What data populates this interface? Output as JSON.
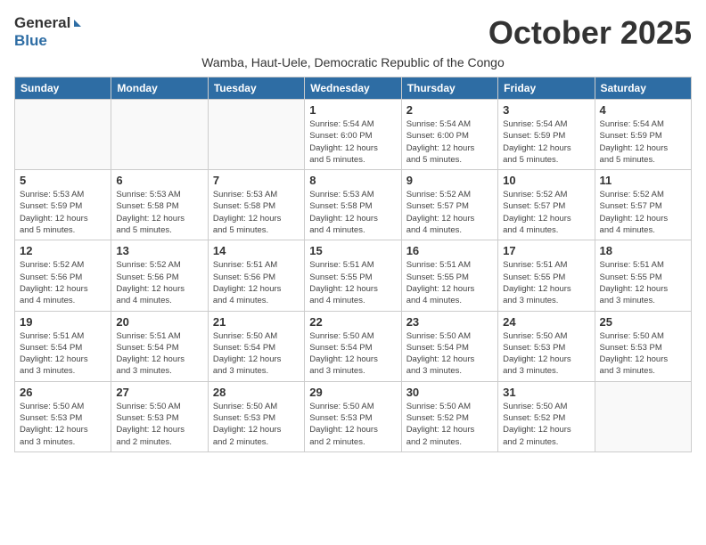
{
  "header": {
    "logo_general": "General",
    "logo_blue": "Blue",
    "month_title": "October 2025",
    "subtitle": "Wamba, Haut-Uele, Democratic Republic of the Congo"
  },
  "weekdays": [
    "Sunday",
    "Monday",
    "Tuesday",
    "Wednesday",
    "Thursday",
    "Friday",
    "Saturday"
  ],
  "weeks": [
    [
      {
        "day": "",
        "info": ""
      },
      {
        "day": "",
        "info": ""
      },
      {
        "day": "",
        "info": ""
      },
      {
        "day": "1",
        "info": "Sunrise: 5:54 AM\nSunset: 6:00 PM\nDaylight: 12 hours\nand 5 minutes."
      },
      {
        "day": "2",
        "info": "Sunrise: 5:54 AM\nSunset: 6:00 PM\nDaylight: 12 hours\nand 5 minutes."
      },
      {
        "day": "3",
        "info": "Sunrise: 5:54 AM\nSunset: 5:59 PM\nDaylight: 12 hours\nand 5 minutes."
      },
      {
        "day": "4",
        "info": "Sunrise: 5:54 AM\nSunset: 5:59 PM\nDaylight: 12 hours\nand 5 minutes."
      }
    ],
    [
      {
        "day": "5",
        "info": "Sunrise: 5:53 AM\nSunset: 5:59 PM\nDaylight: 12 hours\nand 5 minutes."
      },
      {
        "day": "6",
        "info": "Sunrise: 5:53 AM\nSunset: 5:58 PM\nDaylight: 12 hours\nand 5 minutes."
      },
      {
        "day": "7",
        "info": "Sunrise: 5:53 AM\nSunset: 5:58 PM\nDaylight: 12 hours\nand 5 minutes."
      },
      {
        "day": "8",
        "info": "Sunrise: 5:53 AM\nSunset: 5:58 PM\nDaylight: 12 hours\nand 4 minutes."
      },
      {
        "day": "9",
        "info": "Sunrise: 5:52 AM\nSunset: 5:57 PM\nDaylight: 12 hours\nand 4 minutes."
      },
      {
        "day": "10",
        "info": "Sunrise: 5:52 AM\nSunset: 5:57 PM\nDaylight: 12 hours\nand 4 minutes."
      },
      {
        "day": "11",
        "info": "Sunrise: 5:52 AM\nSunset: 5:57 PM\nDaylight: 12 hours\nand 4 minutes."
      }
    ],
    [
      {
        "day": "12",
        "info": "Sunrise: 5:52 AM\nSunset: 5:56 PM\nDaylight: 12 hours\nand 4 minutes."
      },
      {
        "day": "13",
        "info": "Sunrise: 5:52 AM\nSunset: 5:56 PM\nDaylight: 12 hours\nand 4 minutes."
      },
      {
        "day": "14",
        "info": "Sunrise: 5:51 AM\nSunset: 5:56 PM\nDaylight: 12 hours\nand 4 minutes."
      },
      {
        "day": "15",
        "info": "Sunrise: 5:51 AM\nSunset: 5:55 PM\nDaylight: 12 hours\nand 4 minutes."
      },
      {
        "day": "16",
        "info": "Sunrise: 5:51 AM\nSunset: 5:55 PM\nDaylight: 12 hours\nand 4 minutes."
      },
      {
        "day": "17",
        "info": "Sunrise: 5:51 AM\nSunset: 5:55 PM\nDaylight: 12 hours\nand 3 minutes."
      },
      {
        "day": "18",
        "info": "Sunrise: 5:51 AM\nSunset: 5:55 PM\nDaylight: 12 hours\nand 3 minutes."
      }
    ],
    [
      {
        "day": "19",
        "info": "Sunrise: 5:51 AM\nSunset: 5:54 PM\nDaylight: 12 hours\nand 3 minutes."
      },
      {
        "day": "20",
        "info": "Sunrise: 5:51 AM\nSunset: 5:54 PM\nDaylight: 12 hours\nand 3 minutes."
      },
      {
        "day": "21",
        "info": "Sunrise: 5:50 AM\nSunset: 5:54 PM\nDaylight: 12 hours\nand 3 minutes."
      },
      {
        "day": "22",
        "info": "Sunrise: 5:50 AM\nSunset: 5:54 PM\nDaylight: 12 hours\nand 3 minutes."
      },
      {
        "day": "23",
        "info": "Sunrise: 5:50 AM\nSunset: 5:54 PM\nDaylight: 12 hours\nand 3 minutes."
      },
      {
        "day": "24",
        "info": "Sunrise: 5:50 AM\nSunset: 5:53 PM\nDaylight: 12 hours\nand 3 minutes."
      },
      {
        "day": "25",
        "info": "Sunrise: 5:50 AM\nSunset: 5:53 PM\nDaylight: 12 hours\nand 3 minutes."
      }
    ],
    [
      {
        "day": "26",
        "info": "Sunrise: 5:50 AM\nSunset: 5:53 PM\nDaylight: 12 hours\nand 3 minutes."
      },
      {
        "day": "27",
        "info": "Sunrise: 5:50 AM\nSunset: 5:53 PM\nDaylight: 12 hours\nand 2 minutes."
      },
      {
        "day": "28",
        "info": "Sunrise: 5:50 AM\nSunset: 5:53 PM\nDaylight: 12 hours\nand 2 minutes."
      },
      {
        "day": "29",
        "info": "Sunrise: 5:50 AM\nSunset: 5:53 PM\nDaylight: 12 hours\nand 2 minutes."
      },
      {
        "day": "30",
        "info": "Sunrise: 5:50 AM\nSunset: 5:52 PM\nDaylight: 12 hours\nand 2 minutes."
      },
      {
        "day": "31",
        "info": "Sunrise: 5:50 AM\nSunset: 5:52 PM\nDaylight: 12 hours\nand 2 minutes."
      },
      {
        "day": "",
        "info": ""
      }
    ]
  ]
}
